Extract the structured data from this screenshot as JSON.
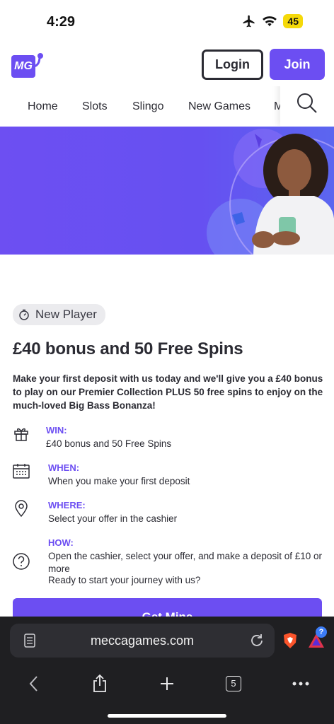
{
  "status": {
    "time": "4:29",
    "battery": "45"
  },
  "header": {
    "logo_text": "MG",
    "login_label": "Login",
    "join_label": "Join"
  },
  "nav": {
    "items": [
      "Home",
      "Slots",
      "Slingo",
      "New Games",
      "M"
    ]
  },
  "promo": {
    "badge": "New Player",
    "headline": "£40 bonus and 50 Free Spins",
    "intro": "Make your first deposit with us today and we'll give you a £40 bonus to play on our Premier Collection PLUS 50 free spins to enjoy on the much-loved Big Bass Bonanza!",
    "details": [
      {
        "title": "WIN:",
        "text": "£40 bonus and 50 Free Spins",
        "icon": "gift-icon"
      },
      {
        "title": "WHEN:",
        "text": "When you make your first deposit",
        "icon": "calendar-icon"
      },
      {
        "title": "WHERE:",
        "text": "Select your offer in the cashier",
        "icon": "location-pin-icon"
      },
      {
        "title": "HOW:",
        "text": "Open the cashier, select your offer, and make a deposit of £10 or more",
        "text2": "Ready to start your journey with us?",
        "icon": "question-circle-icon"
      }
    ],
    "cta_label": "Get Mine"
  },
  "browser": {
    "url": "meccagames.com",
    "tab_count": "5",
    "notification_count": "?"
  },
  "colors": {
    "brand": "#6c4ef2",
    "text": "#2b2b33"
  }
}
